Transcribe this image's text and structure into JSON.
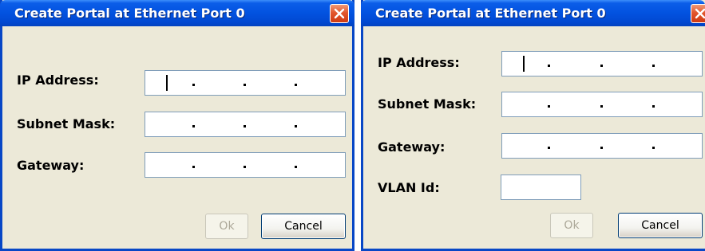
{
  "dialogs": [
    {
      "title": "Create Portal at Ethernet Port 0",
      "fields": [
        {
          "label": "IP Address:",
          "value": "   .    .    .   ",
          "focused": true
        },
        {
          "label": "Subnet Mask:",
          "value": "   .    .    .   ",
          "focused": false
        },
        {
          "label": "Gateway:",
          "value": "   .    .    .   ",
          "focused": false
        }
      ],
      "buttons": {
        "ok": "Ok",
        "cancel": "Cancel",
        "ok_enabled": false
      }
    },
    {
      "title": "Create Portal at Ethernet Port 0",
      "fields": [
        {
          "label": "IP Address:",
          "value": "   .    .    .   ",
          "focused": true
        },
        {
          "label": "Subnet Mask:",
          "value": "   .    .    .   ",
          "focused": false
        },
        {
          "label": "Gateway:",
          "value": "   .    .    .   ",
          "focused": false
        }
      ],
      "vlan": {
        "label": "VLAN Id:",
        "value": ""
      },
      "buttons": {
        "ok": "Ok",
        "cancel": "Cancel",
        "ok_enabled": false
      }
    }
  ],
  "icons": {
    "close": "close-x-icon"
  },
  "colors": {
    "titlebar": "#0252e0",
    "frame": "#0847c6",
    "dialog_bg": "#ece9d8",
    "close_button": "#e2562d",
    "field_border": "#7f9db9",
    "disabled_text": "#aca899"
  }
}
